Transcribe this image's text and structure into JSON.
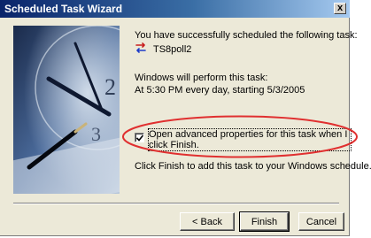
{
  "window": {
    "title": "Scheduled Task Wizard",
    "close_label": "x"
  },
  "content": {
    "success_text": "You have successfully scheduled the following task:",
    "task_name": "TS8poll2",
    "perform_label": "Windows will perform this task:",
    "schedule_text": "At 5:30 PM every day, starting 5/3/2005",
    "checkbox": {
      "checked": true,
      "label": "Open advanced properties for this task when I click Finish."
    },
    "finish_hint": "Click Finish to add this task to your Windows schedule."
  },
  "buttons": {
    "back": "< Back",
    "finish": "Finish",
    "cancel": "Cancel"
  },
  "colors": {
    "highlight_oval": "#e03030",
    "title_start": "#0a246a",
    "title_end": "#a6caf0"
  },
  "icons": {
    "task": "scheduled-task-icon",
    "close": "close-icon"
  }
}
